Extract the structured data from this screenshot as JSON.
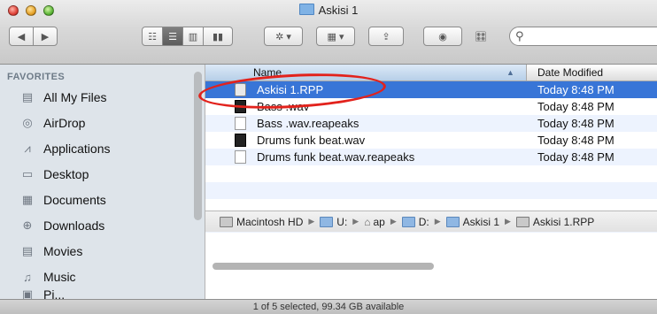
{
  "window": {
    "title": "Askisi 1"
  },
  "toolbar": {
    "back": "◀",
    "forward": "▶",
    "view_icon": "☷",
    "view_list": "☰",
    "view_columns": "▥",
    "view_coverflow": "▮▮",
    "action": "✲ ▾",
    "arrange": "▦ ▾",
    "share": "⇪",
    "quicklook": "◉",
    "reaper": "🎛",
    "search_placeholder": ""
  },
  "sidebar": {
    "heading": "FAVORITES",
    "items": [
      {
        "label": "All My Files",
        "icon": "all-files"
      },
      {
        "label": "AirDrop",
        "icon": "airdrop"
      },
      {
        "label": "Applications",
        "icon": "applications"
      },
      {
        "label": "Desktop",
        "icon": "desktop"
      },
      {
        "label": "Documents",
        "icon": "documents"
      },
      {
        "label": "Downloads",
        "icon": "downloads"
      },
      {
        "label": "Movies",
        "icon": "movies"
      },
      {
        "label": "Music",
        "icon": "music"
      },
      {
        "label": "Pi...",
        "icon": "pictures"
      }
    ]
  },
  "list": {
    "columns": {
      "name": "Name",
      "date": "Date Modified"
    },
    "rows": [
      {
        "name": "Askisi 1.RPP",
        "date": "Today 8:48 PM",
        "type": "rpp",
        "selected": true
      },
      {
        "name": "Bass .wav",
        "date": "Today 8:48 PM",
        "type": "wav"
      },
      {
        "name": "Bass .wav.reapeaks",
        "date": "Today 8:48 PM",
        "type": "doc"
      },
      {
        "name": "Drums funk beat.wav",
        "date": "Today 8:48 PM",
        "type": "wav"
      },
      {
        "name": "Drums funk beat.wav.reapeaks",
        "date": "Today 8:48 PM",
        "type": "doc"
      }
    ]
  },
  "pathbar": {
    "items": [
      "Macintosh HD",
      "U:",
      "ap",
      "D:",
      "Askisi 1",
      "Askisi 1.RPP"
    ]
  },
  "status": {
    "text": "1 of 5 selected, 99.34 GB available"
  },
  "colors": {
    "selection": "#3875d7",
    "annotation": "#e2221c"
  }
}
